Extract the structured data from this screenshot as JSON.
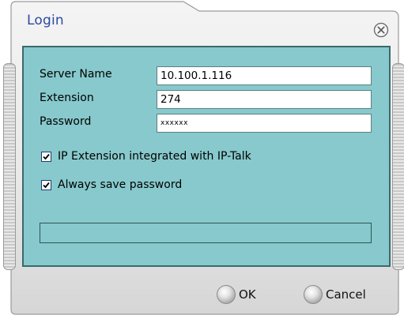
{
  "window": {
    "title": "Login"
  },
  "form": {
    "server_name_label": "Server Name",
    "server_name_value": "10.100.1.116",
    "extension_label": "Extension",
    "extension_value": "274",
    "password_label": "Password",
    "password_value": "xxxxxx"
  },
  "options": {
    "ip_talk_label": "IP Extension integrated with IP-Talk",
    "ip_talk_checked": true,
    "save_password_label": "Always save password",
    "save_password_checked": true
  },
  "buttons": {
    "ok_label": "OK",
    "cancel_label": "Cancel"
  },
  "colors": {
    "panel": "#87c9cc",
    "title": "#2b4aa0"
  }
}
